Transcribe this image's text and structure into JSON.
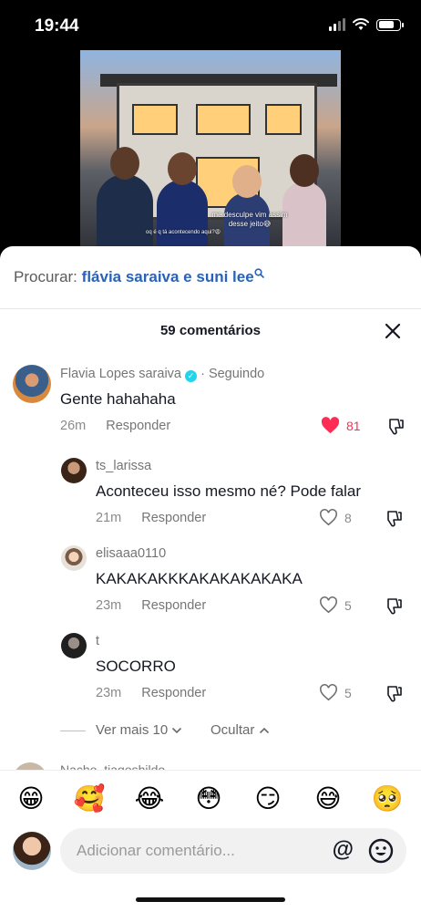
{
  "status_bar": {
    "time": "19:44"
  },
  "video": {
    "caption": "me desculpe vim assim desse jeito😅",
    "subcaption": "oq é q tá acontecendo aqui?😩"
  },
  "search": {
    "label": "Procurar:",
    "term": "flávia saraiva e suni lee"
  },
  "comments_header": {
    "count_label": "59 comentários"
  },
  "comments": [
    {
      "user": "Flavia Lopes saraiva",
      "badge": "·",
      "status": "Seguindo",
      "text": "Gente hahahaha",
      "time": "26m",
      "reply": "Responder",
      "likes": "81",
      "liked": true
    },
    {
      "user": "ts_larissa",
      "text": "Aconteceu isso mesmo né? Pode falar",
      "time": "21m",
      "reply": "Responder",
      "likes": "8",
      "liked": false
    },
    {
      "user": "elisaaa0110",
      "text": "KAKAKAKKKAKAKAKAKAKA",
      "time": "23m",
      "reply": "Responder",
      "likes": "5",
      "liked": false
    },
    {
      "user": "t",
      "text": "SOCORRO",
      "time": "23m",
      "reply": "Responder",
      "likes": "5",
      "liked": false
    }
  ],
  "thread_controls": {
    "more": "Ver mais 10",
    "hide": "Ocultar"
  },
  "next_comment_peek": "Nacho_tiagoshildo",
  "emoji_bar": [
    "😁",
    "🥰",
    "😂",
    "😳",
    "😏",
    "😅",
    "🥺"
  ],
  "input": {
    "placeholder": "Adicionar comentário...",
    "at": "@"
  },
  "colors": {
    "accent_link": "#2b62b5",
    "like_red": "#fe2c55",
    "verified": "#20d5ec"
  }
}
